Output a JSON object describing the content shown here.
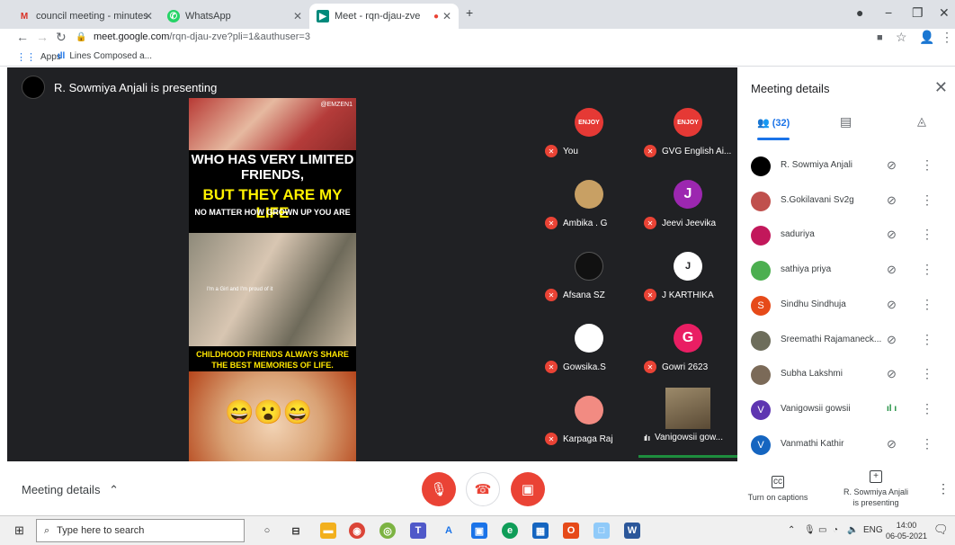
{
  "browser": {
    "tabs": [
      {
        "title": "council meeting - minutes - vadi",
        "icon": "gmail-icon"
      },
      {
        "title": "WhatsApp",
        "icon": "whatsapp-icon"
      },
      {
        "title": "Meet - rqn-djau-zve",
        "icon": "meet-icon"
      }
    ],
    "new_tab": "+",
    "url_host": "meet.google.com",
    "url_path": "/rqn-djau-zve?pli=1&authuser=3",
    "bookmarks": [
      {
        "label": "Apps",
        "icon": "apps-grid-icon"
      },
      {
        "label": "Lines Composed a...",
        "icon": "bookmark-icon"
      }
    ]
  },
  "stage": {
    "presenter_banner": "R. Sowmiya Anjali is presenting",
    "slide": {
      "watermark": "@EMZEN1",
      "headline_1": "WHO HAS VERY LIMITED FRIENDS,",
      "headline_2": "BUT THEY ARE MY LIFE",
      "subline": "NO MATTER HOW GROWN UP YOU ARE",
      "caption": "CHILDHOOD FRIENDS ALWAYS SHARE THE BEST MEMORIES OF LIFE.",
      "photo_text": "I'm a Girl and I'm proud of it"
    },
    "tiles": [
      {
        "name": "You",
        "avatar_text": "ENJOY",
        "avatar_color": "#e53935",
        "status": "muted"
      },
      {
        "name": "GVG English Ai...",
        "avatar_text": "ENJOY",
        "avatar_color": "#e53935",
        "status": "muted"
      },
      {
        "name": "Ambika . G",
        "avatar_text": "",
        "avatar_color": "#c8a064",
        "status": "muted"
      },
      {
        "name": "Jeevi Jeevika",
        "avatar_text": "J",
        "avatar_color": "#9c27b0",
        "status": "muted"
      },
      {
        "name": "Afsana SZ",
        "avatar_text": "",
        "avatar_color": "#111111",
        "status": "muted"
      },
      {
        "name": "J KARTHIKA",
        "avatar_text": "J",
        "avatar_color": "#ffffff",
        "status": "muted"
      },
      {
        "name": "Gowsika.S",
        "avatar_text": "",
        "avatar_color": "#ffffff",
        "status": "muted"
      },
      {
        "name": "Gowri 2623",
        "avatar_text": "G",
        "avatar_color": "#e91e63",
        "status": "muted"
      },
      {
        "name": "Karpaga Raj",
        "avatar_text": "",
        "avatar_color": "#f28b82",
        "status": "muted"
      },
      {
        "name": "Vanigowsii gow...",
        "avatar_text": "",
        "avatar_color": "#8d7c5a",
        "status": "speaking"
      }
    ]
  },
  "side_panel": {
    "title": "Meeting details",
    "people_count": "(32)",
    "participants": [
      {
        "name": "R. Sowmiya Anjali",
        "initial": "",
        "color": "#000000",
        "mic": "muted"
      },
      {
        "name": "S.Gokilavani Sv2g",
        "initial": "",
        "color": "#c0504d",
        "mic": "muted"
      },
      {
        "name": "saduriya",
        "initial": "",
        "color": "#c2185b",
        "mic": "muted"
      },
      {
        "name": "sathiya priya",
        "initial": "",
        "color": "#4caf50",
        "mic": "muted"
      },
      {
        "name": "Sindhu Sindhuja",
        "initial": "S",
        "color": "#e64a19",
        "mic": "muted"
      },
      {
        "name": "Sreemathi Rajamaneck...",
        "initial": "",
        "color": "#6d6d5b",
        "mic": "muted"
      },
      {
        "name": "Subha Lakshmi",
        "initial": "",
        "color": "#7b6a58",
        "mic": "muted"
      },
      {
        "name": "Vanigowsii gowsii",
        "initial": "V",
        "color": "#5e35b1",
        "mic": "speaking"
      },
      {
        "name": "Vanmathi Kathir",
        "initial": "V",
        "color": "#1565c0",
        "mic": "muted"
      }
    ]
  },
  "bottom_bar": {
    "meeting_details": "Meeting details",
    "captions_label": "Turn on captions",
    "presenting_label_1": "R. Sowmiya Anjali",
    "presenting_label_2": "is presenting"
  },
  "taskbar": {
    "search_placeholder": "Type here to search",
    "language": "ENG",
    "time": "14:00",
    "date": "06-05-2021"
  }
}
